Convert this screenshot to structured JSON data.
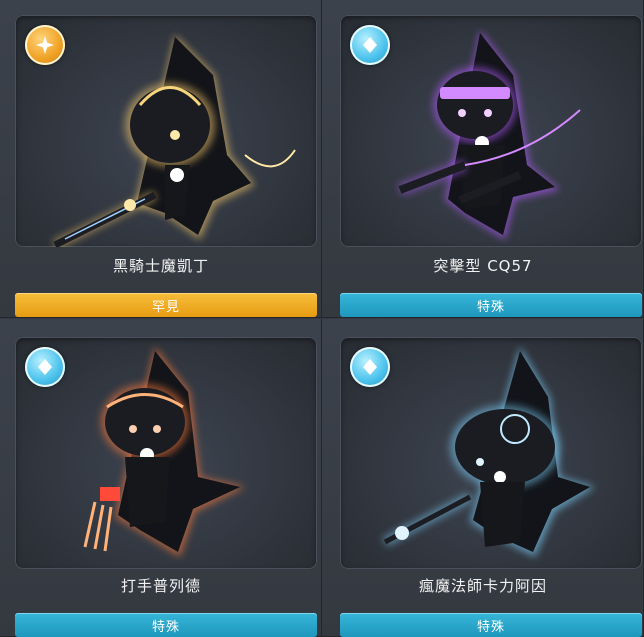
{
  "cards": [
    {
      "name": "黑騎士魔凱丁",
      "tag": "罕見",
      "tier_icon": "star-medal-icon",
      "tier_color": "#f0a227",
      "glow_color": "#f4c66a"
    },
    {
      "name": "突擊型 CQ57",
      "tag": "特殊",
      "tier_icon": "diamond-medal-icon",
      "tier_color": "#36b6d8",
      "glow_color": "#b35cff"
    },
    {
      "name": "打手普列德",
      "tag": "特殊",
      "tier_icon": "diamond-medal-icon",
      "tier_color": "#36b6d8",
      "glow_color": "#ff7a3a"
    },
    {
      "name": "瘋魔法師卡力阿因",
      "tag": "特殊",
      "tier_icon": "diamond-medal-icon",
      "tier_color": "#36b6d8",
      "glow_color": "#7fd4ff"
    }
  ]
}
